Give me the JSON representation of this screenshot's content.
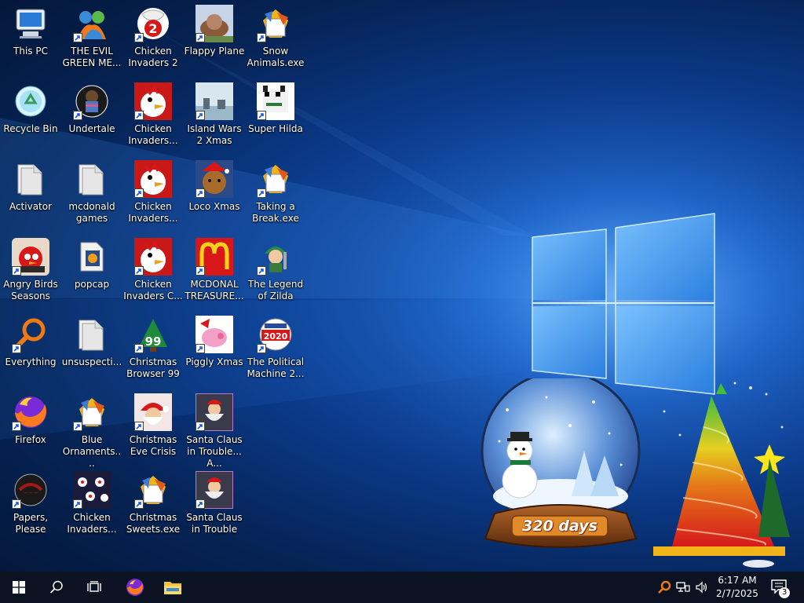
{
  "desktop": {
    "icons": [
      {
        "label": "This PC",
        "icon": "this-pc-icon",
        "shortcut": false
      },
      {
        "label": "THE EVIL GREEN ME...",
        "icon": "evil-green-me-icon",
        "shortcut": true
      },
      {
        "label": "Chicken Invaders 2",
        "icon": "chicken-invaders-2-icon",
        "shortcut": true
      },
      {
        "label": "Flappy Plane",
        "icon": "flappy-plane-icon",
        "shortcut": true
      },
      {
        "label": "Snow Animals.exe",
        "icon": "exe-icon",
        "shortcut": true
      },
      {
        "label": "Recycle Bin",
        "icon": "recycle-bin-icon",
        "shortcut": false
      },
      {
        "label": "Undertale",
        "icon": "undertale-icon",
        "shortcut": true
      },
      {
        "label": "Chicken Invaders...",
        "icon": "chicken-invaders-icon",
        "shortcut": true
      },
      {
        "label": "Island Wars 2 Xmas",
        "icon": "island-wars-icon",
        "shortcut": true
      },
      {
        "label": "Super Hilda",
        "icon": "super-hilda-icon",
        "shortcut": true
      },
      {
        "label": "Activator",
        "icon": "folder-icon",
        "shortcut": false
      },
      {
        "label": "mcdonald games",
        "icon": "folder-icon",
        "shortcut": false
      },
      {
        "label": "Chicken Invaders...",
        "icon": "chicken-invaders-icon",
        "shortcut": true
      },
      {
        "label": "Loco Xmas",
        "icon": "loco-xmas-icon",
        "shortcut": true
      },
      {
        "label": "Taking a Break.exe",
        "icon": "exe-icon",
        "shortcut": true
      },
      {
        "label": "Angry Birds Seasons",
        "icon": "angry-birds-icon",
        "shortcut": true
      },
      {
        "label": "popcap",
        "icon": "popcap-folder-icon",
        "shortcut": false
      },
      {
        "label": "Chicken Invaders C...",
        "icon": "chicken-invaders-icon",
        "shortcut": true
      },
      {
        "label": "MCDONAL TREASURE...",
        "icon": "mcdonalds-icon",
        "shortcut": true
      },
      {
        "label": "The Legend of Zilda",
        "icon": "legend-zilda-icon",
        "shortcut": true
      },
      {
        "label": "Everything",
        "icon": "everything-search-icon",
        "shortcut": true
      },
      {
        "label": "unsuspecti...",
        "icon": "folder-icon",
        "shortcut": false
      },
      {
        "label": "Christmas Browser 99",
        "icon": "christmas-browser-icon",
        "shortcut": true
      },
      {
        "label": "Piggly Xmas",
        "icon": "piggly-xmas-icon",
        "shortcut": true
      },
      {
        "label": "The Political Machine 2...",
        "icon": "political-machine-icon",
        "shortcut": true
      },
      {
        "label": "Firefox",
        "icon": "firefox-icon",
        "shortcut": true
      },
      {
        "label": "Blue Ornaments....",
        "icon": "exe-icon",
        "shortcut": true
      },
      {
        "label": "Christmas Eve Crisis",
        "icon": "santa-icon",
        "shortcut": true
      },
      {
        "label": "Santa Claus in Trouble... A...",
        "icon": "santa-claus-trouble-icon",
        "shortcut": true
      },
      {
        "label": "Papers, Please",
        "icon": "papers-please-icon",
        "shortcut": true
      },
      {
        "label": "Chicken Invaders...",
        "icon": "chicken-invaders-grid-icon",
        "shortcut": true
      },
      {
        "label": "Christmas Sweets.exe",
        "icon": "exe-icon",
        "shortcut": true
      },
      {
        "label": "Santa Claus in Trouble",
        "icon": "santa-claus-trouble-icon",
        "shortcut": true
      }
    ]
  },
  "widget": {
    "countdown_text": "320 days"
  },
  "taskbar": {
    "start": "windows-start-icon",
    "search": "search-icon",
    "task_view": "task-view-icon",
    "pinned": [
      "firefox-icon",
      "file-explorer-icon"
    ],
    "tray": [
      "everything-tray-icon",
      "network-icon",
      "volume-icon"
    ],
    "clock": {
      "time": "6:17 AM",
      "date": "2/7/2025"
    },
    "notifications": {
      "count": "3"
    }
  }
}
